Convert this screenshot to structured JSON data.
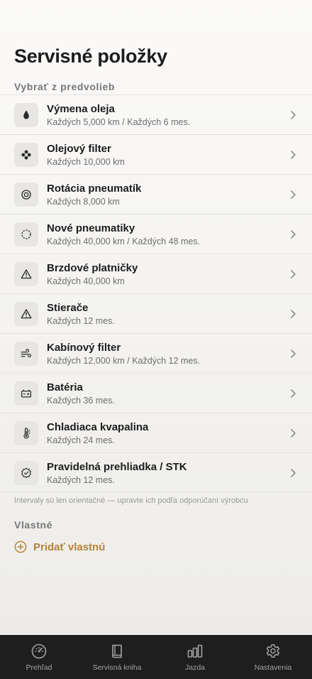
{
  "page": {
    "title": "Servisné položky"
  },
  "presets": {
    "header": "Vybrať z predvolieb",
    "items": [
      {
        "title": "Výmena oleja",
        "interval": "Každých 5,000 km / Každých 6 mes.",
        "icon": "oil-drop-icon"
      },
      {
        "title": "Olejový filter",
        "interval": "Každých 10,000 km",
        "icon": "filter-icon"
      },
      {
        "title": "Rotácia pneumatík",
        "interval": "Každých 8,000 km",
        "icon": "tire-rotation-icon"
      },
      {
        "title": "Nové pneumatiky",
        "interval": "Každých 40,000 km / Každých 48 mes.",
        "icon": "tire-icon"
      },
      {
        "title": "Brzdové platničky",
        "interval": "Každých 40,000 km",
        "icon": "warning-icon"
      },
      {
        "title": "Stierače",
        "interval": "Každých 12 mes.",
        "icon": "warning-icon"
      },
      {
        "title": "Kabínový filter",
        "interval": "Každých 12,000 km / Každých 12 mes.",
        "icon": "air-flow-icon"
      },
      {
        "title": "Batéria",
        "interval": "Každých 36 mes.",
        "icon": "battery-icon"
      },
      {
        "title": "Chladiaca kvapalina",
        "interval": "Každých 24 mes.",
        "icon": "thermometer-icon"
      },
      {
        "title": "Pravidelná prehliadka / STK",
        "interval": "Každých 12 mes.",
        "icon": "checkmark-seal-icon"
      }
    ],
    "note": "Intervaly sú len orientačné — upravte ich podľa odporúčaní výrobcu"
  },
  "custom": {
    "header": "Vlastné",
    "add_label": "Pridať vlastnú"
  },
  "tabbar": {
    "tabs": [
      {
        "label": "Prehľad",
        "icon": "gauge-icon"
      },
      {
        "label": "Servisná kniha",
        "icon": "book-icon"
      },
      {
        "label": "Jazda",
        "icon": "bar-chart-icon"
      },
      {
        "label": "Nastavenia",
        "icon": "gear-icon"
      }
    ]
  },
  "colors": {
    "accent": "#b4833a",
    "background": "#f3f2ef",
    "icon_tile": "#e7e6e2",
    "tabbar": "#1e1e1e",
    "tab_inactive": "#a3a3a6"
  }
}
